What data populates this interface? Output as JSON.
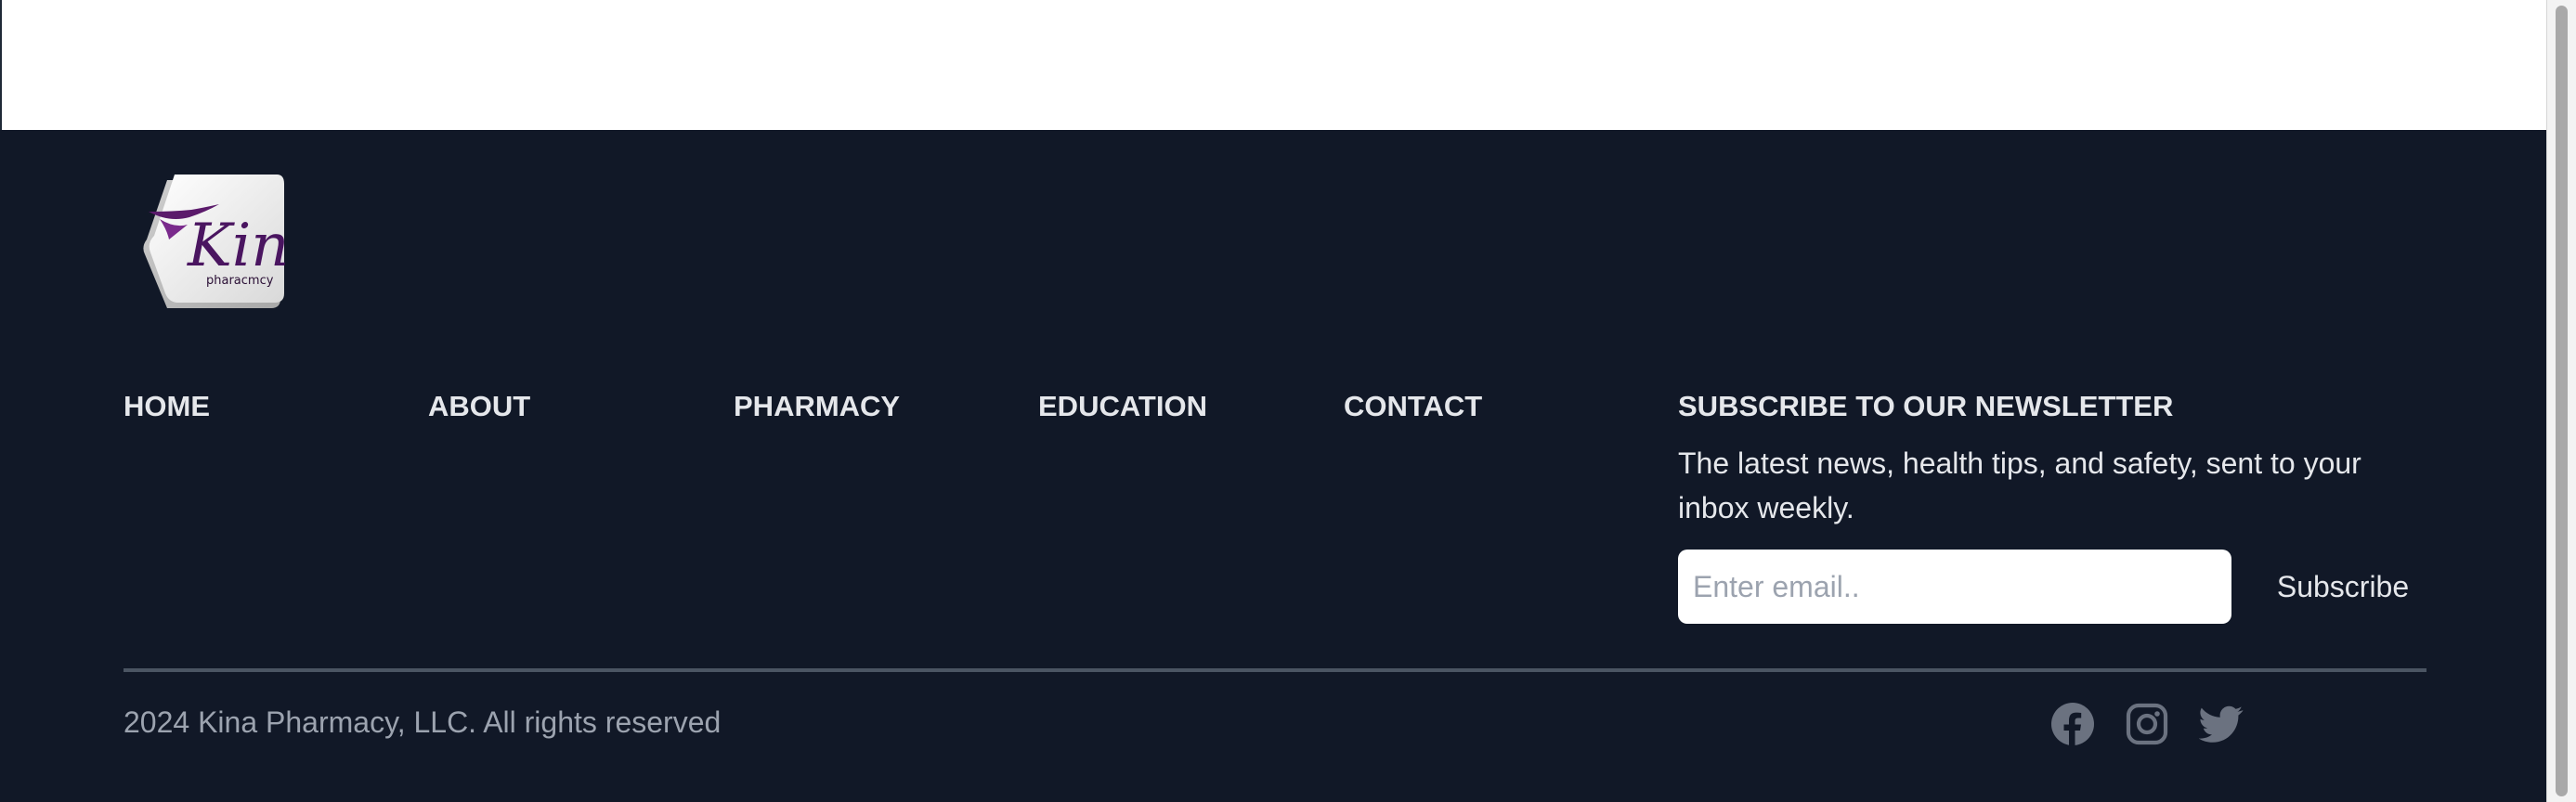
{
  "brand": {
    "logo_name": "Kina",
    "logo_subtext": "pharacmcy"
  },
  "nav": {
    "items": [
      {
        "label": "HOME"
      },
      {
        "label": "ABOUT"
      },
      {
        "label": "PHARMACY"
      },
      {
        "label": "EDUCATION"
      },
      {
        "label": "CONTACT"
      }
    ]
  },
  "newsletter": {
    "title": "SUBSCRIBE TO OUR NEWSLETTER",
    "description": "The latest news, health tips, and safety, sent to your inbox weekly.",
    "email_placeholder": "Enter email..",
    "email_value": "",
    "button_label": "Subscribe"
  },
  "footer": {
    "copyright": "2024 Kina Pharmacy, LLC. All rights reserved",
    "social": [
      {
        "icon": "facebook-icon"
      },
      {
        "icon": "instagram-icon"
      },
      {
        "icon": "twitter-icon"
      }
    ]
  },
  "colors": {
    "footer_bg": "#111827",
    "text_light": "#e5e7eb",
    "text_muted": "#9ca3af",
    "divider": "#4b5563",
    "brand_purple": "#5b1a6b"
  }
}
